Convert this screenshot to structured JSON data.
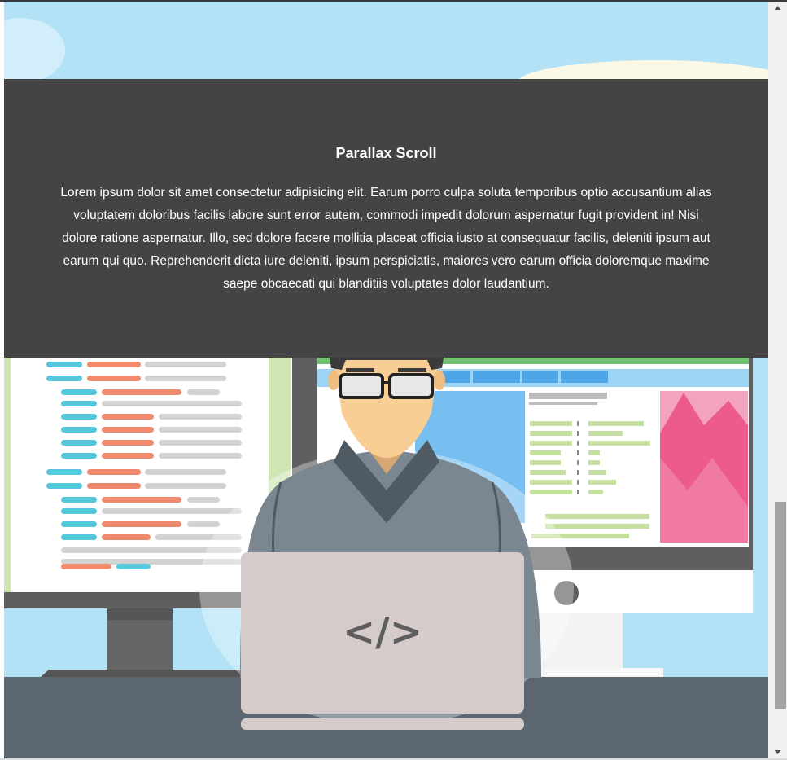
{
  "section": {
    "title": "Parallax Scroll",
    "body": "Lorem ipsum dolor sit amet consectetur adipisicing elit. Earum porro culpa soluta temporibus optio accusantium alias voluptatem doloribus facilis labore sunt error autem, commodi impedit dolorum aspernatur fugit provident in! Nisi dolore ratione aspernatur. Illo, sed dolore facere mollitia placeat officia iusto at consequatur facilis, deleniti ipsum aut earum qui quo. Reprehenderit dicta iure deleniti, ipsum perspiciatis, maiores vero earum officia doloremque maxime saepe obcaecati qui blanditiis voluptates dolor laudantium."
  },
  "illustration": {
    "laptop_symbol": "</>",
    "icon": "developer-illustration"
  },
  "scrollbar": {
    "position_fraction": 0.72,
    "up_icon": "scroll-up-arrow-icon",
    "down_icon": "scroll-down-arrow-icon"
  },
  "colors": {
    "sky": "#b3e2f7",
    "band": "#444444",
    "desk": "#5b6670",
    "monitor_frame": "#5f5f5f",
    "shirt": "#7a8791",
    "laptop": "#d6cbcb",
    "code_blue": "#56c8dc",
    "code_orange": "#f08a6c",
    "code_gray": "#d3d3d3",
    "pink_panel": "#ec5b8c",
    "green_line": "#c5dfa0"
  }
}
